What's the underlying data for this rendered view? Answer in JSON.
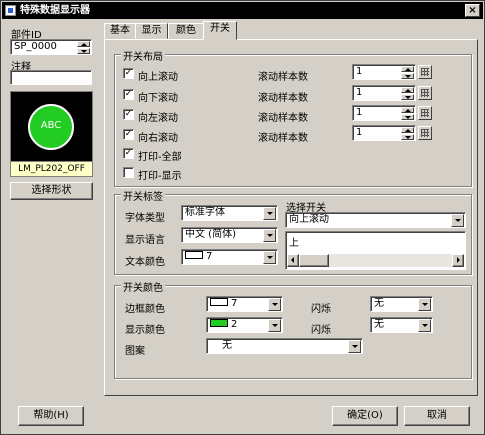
{
  "window": {
    "title": "特殊数据显示器",
    "close_glyph": "×"
  },
  "left": {
    "part_id_label": "部件ID",
    "part_id_value": "SP_0000",
    "comment_label": "注释",
    "comment_value": "",
    "preview_text": "ABC",
    "preview_color": "#22cc22",
    "shape_name": "LM_PL202_OFF",
    "select_shape_button": "选择形状"
  },
  "tabs": [
    {
      "label": "基本"
    },
    {
      "label": "显示"
    },
    {
      "label": "颜色"
    },
    {
      "label": "开关"
    }
  ],
  "layout_group": {
    "title": "开关布局",
    "rows": [
      {
        "label": "向上滚动",
        "checked": true,
        "sample_label": "滚动样本数",
        "sample_value": "1"
      },
      {
        "label": "向下滚动",
        "checked": true,
        "sample_label": "滚动样本数",
        "sample_value": "1"
      },
      {
        "label": "向左滚动",
        "checked": true,
        "sample_label": "滚动样本数",
        "sample_value": "1"
      },
      {
        "label": "向右滚动",
        "checked": true,
        "sample_label": "滚动样本数",
        "sample_value": "1"
      }
    ],
    "print_all": {
      "label": "打印-全部",
      "checked": true
    },
    "print_display": {
      "label": "打印-显示",
      "checked": false
    }
  },
  "label_group": {
    "title": "开关标签",
    "font_type_label": "字体类型",
    "font_type_value": "标准字体",
    "language_label": "显示语言",
    "language_value": "中文 (简体)",
    "text_color_label": "文本颜色",
    "text_color_value": "7",
    "text_color_swatch": "#ffffff",
    "select_switch_label": "选择开关",
    "select_switch_value": "向上滚动",
    "switch_text": "上"
  },
  "color_group": {
    "title": "开关颜色",
    "border_color_label": "边框颜色",
    "border_color_value": "7",
    "border_color_swatch": "#ffffff",
    "blink1_label": "闪烁",
    "blink1_value": "无",
    "display_color_label": "显示颜色",
    "display_color_value": "2",
    "display_color_swatch": "#22cc22",
    "blink2_label": "闪烁",
    "blink2_value": "无",
    "pattern_label": "图案",
    "pattern_value": "无"
  },
  "footer": {
    "help_button": "帮助(H)",
    "ok_button": "确定(O)",
    "cancel_button": "取消"
  }
}
